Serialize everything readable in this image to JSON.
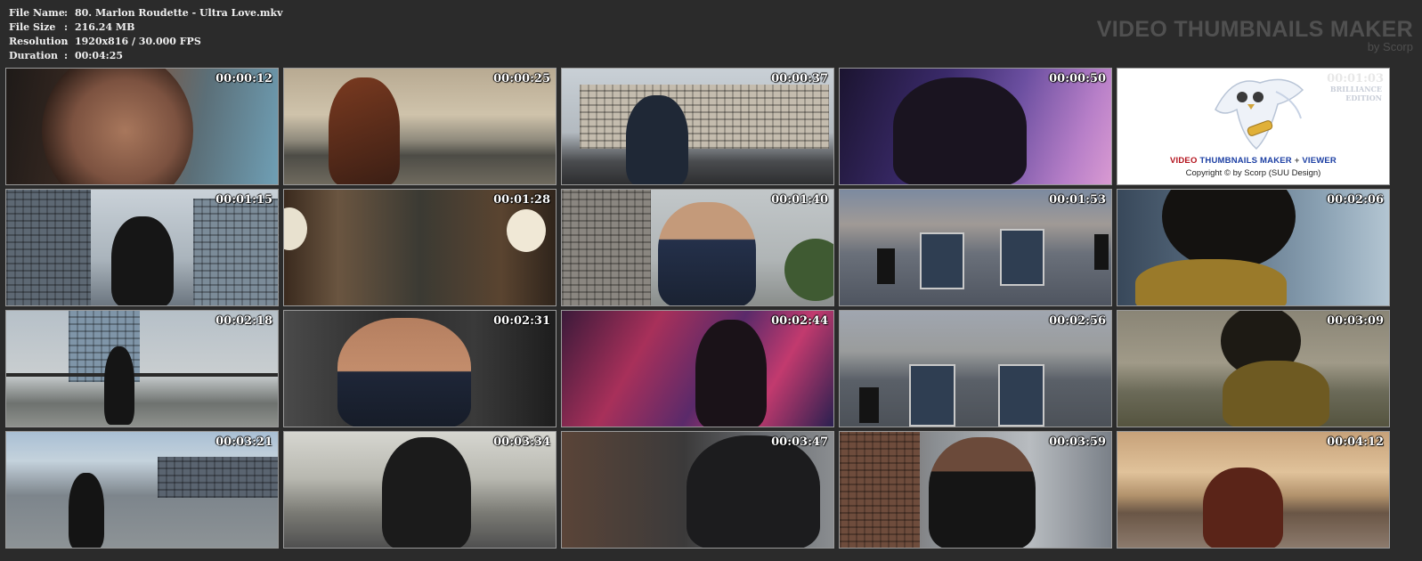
{
  "file_info": {
    "file_name_label": "File Name",
    "file_name": "80. Marlon Roudette - Ultra Love.mkv",
    "file_size_label": "File Size",
    "file_size": "216.24 MB",
    "resolution_label": "Resolution",
    "resolution": "1920x816 / 30.000 FPS",
    "duration_label": "Duration",
    "duration": "00:04:25",
    "separator": ":"
  },
  "brand": {
    "title": "VIDEO THUMBNAILS MAKER",
    "byline": "by Scorp"
  },
  "logo_tile": {
    "timestamp": "00:01:03",
    "edition_line1": "BRILLIANCE",
    "edition_line2": "EDITION",
    "title_part1": "VIDEO",
    "title_part2": "THUMBNAILS MAKER",
    "title_part3": "+",
    "title_part4": "VIEWER",
    "copyright": "Copyright © by Scorp (SUU Design)"
  },
  "thumbnails": [
    {
      "timestamp": "00:00:12"
    },
    {
      "timestamp": "00:00:25"
    },
    {
      "timestamp": "00:00:37"
    },
    {
      "timestamp": "00:00:50"
    },
    {
      "timestamp": "00:01:15"
    },
    {
      "timestamp": "00:01:28"
    },
    {
      "timestamp": "00:01:40"
    },
    {
      "timestamp": "00:01:53"
    },
    {
      "timestamp": "00:02:06"
    },
    {
      "timestamp": "00:02:18"
    },
    {
      "timestamp": "00:02:31"
    },
    {
      "timestamp": "00:02:44"
    },
    {
      "timestamp": "00:02:56"
    },
    {
      "timestamp": "00:03:09"
    },
    {
      "timestamp": "00:03:21"
    },
    {
      "timestamp": "00:03:34"
    },
    {
      "timestamp": "00:03:47"
    },
    {
      "timestamp": "00:03:59"
    },
    {
      "timestamp": "00:04:12"
    }
  ],
  "colors": {
    "background": "#2b2b2b",
    "brand_text": "#505050",
    "thumb_border": "#9a9a9a"
  }
}
